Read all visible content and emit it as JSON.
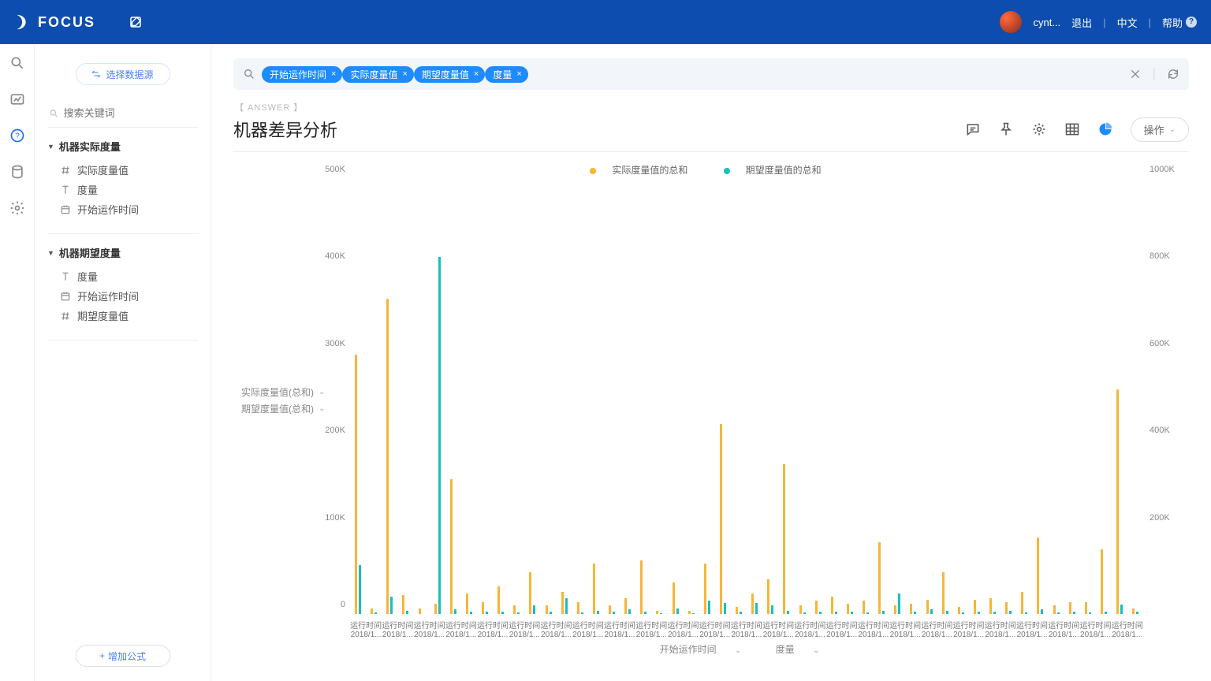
{
  "header": {
    "product": "FOCUS",
    "user": "cynt...",
    "logout": "退出",
    "lang": "中文",
    "help": "帮助"
  },
  "sidebar": {
    "select_ds": "选择数据源",
    "search_placeholder": "搜索关键词",
    "group1": {
      "title": "机器实际度量",
      "fields": [
        "实际度量值",
        "度量",
        "开始运作时间"
      ]
    },
    "group2": {
      "title": "机器期望度量",
      "fields": [
        "度量",
        "开始运作时间",
        "期望度量值"
      ]
    },
    "add_formula": "增加公式"
  },
  "query": {
    "chips": [
      "开始运作时间",
      "实际度量值",
      "期望度量值",
      "度量"
    ]
  },
  "answer": {
    "tag": "【 ANSWER 】",
    "title": "机器差异分析",
    "op": "操作"
  },
  "chart_data": {
    "type": "bar",
    "legend": [
      "实际度量值的总和",
      "期望度量值的总和"
    ],
    "y_left": {
      "label": "实际度量值(总和)",
      "ticks": [
        0,
        "100K",
        "200K",
        "300K",
        "400K",
        "500K"
      ],
      "max": 500
    },
    "y_right": {
      "label": "期望度量值(总和)",
      "ticks": [
        "200K",
        "400K",
        "600K",
        "800K",
        "1000K"
      ],
      "max": 1000
    },
    "x_label_top": "运行时间",
    "x_label_bottom": "2018/1...",
    "x_axis_caption": [
      "开始运作时间",
      "度量"
    ],
    "series": [
      {
        "name": "实际度量值的总和",
        "color": "o",
        "values": [
          298,
          6,
          362,
          22,
          6,
          12,
          155,
          24,
          14,
          32,
          10,
          48,
          10,
          25,
          14,
          58,
          10,
          18,
          62,
          4,
          36,
          4,
          58,
          218,
          8,
          24,
          40,
          172,
          10,
          15,
          20,
          12,
          15,
          82,
          10,
          12,
          16,
          48,
          8,
          16,
          18,
          14,
          25,
          88,
          10,
          14,
          14,
          74,
          258,
          6
        ]
      },
      {
        "name": "期望度量值的总和",
        "color": "t",
        "values": [
          112,
          4,
          40,
          8,
          0,
          820,
          10,
          6,
          6,
          6,
          4,
          20,
          6,
          36,
          4,
          8,
          6,
          10,
          6,
          2,
          12,
          2,
          30,
          26,
          6,
          26,
          20,
          8,
          4,
          5,
          6,
          6,
          4,
          8,
          48,
          6,
          10,
          8,
          4,
          6,
          6,
          8,
          4,
          10,
          4,
          6,
          4,
          6,
          22,
          6
        ]
      }
    ]
  }
}
